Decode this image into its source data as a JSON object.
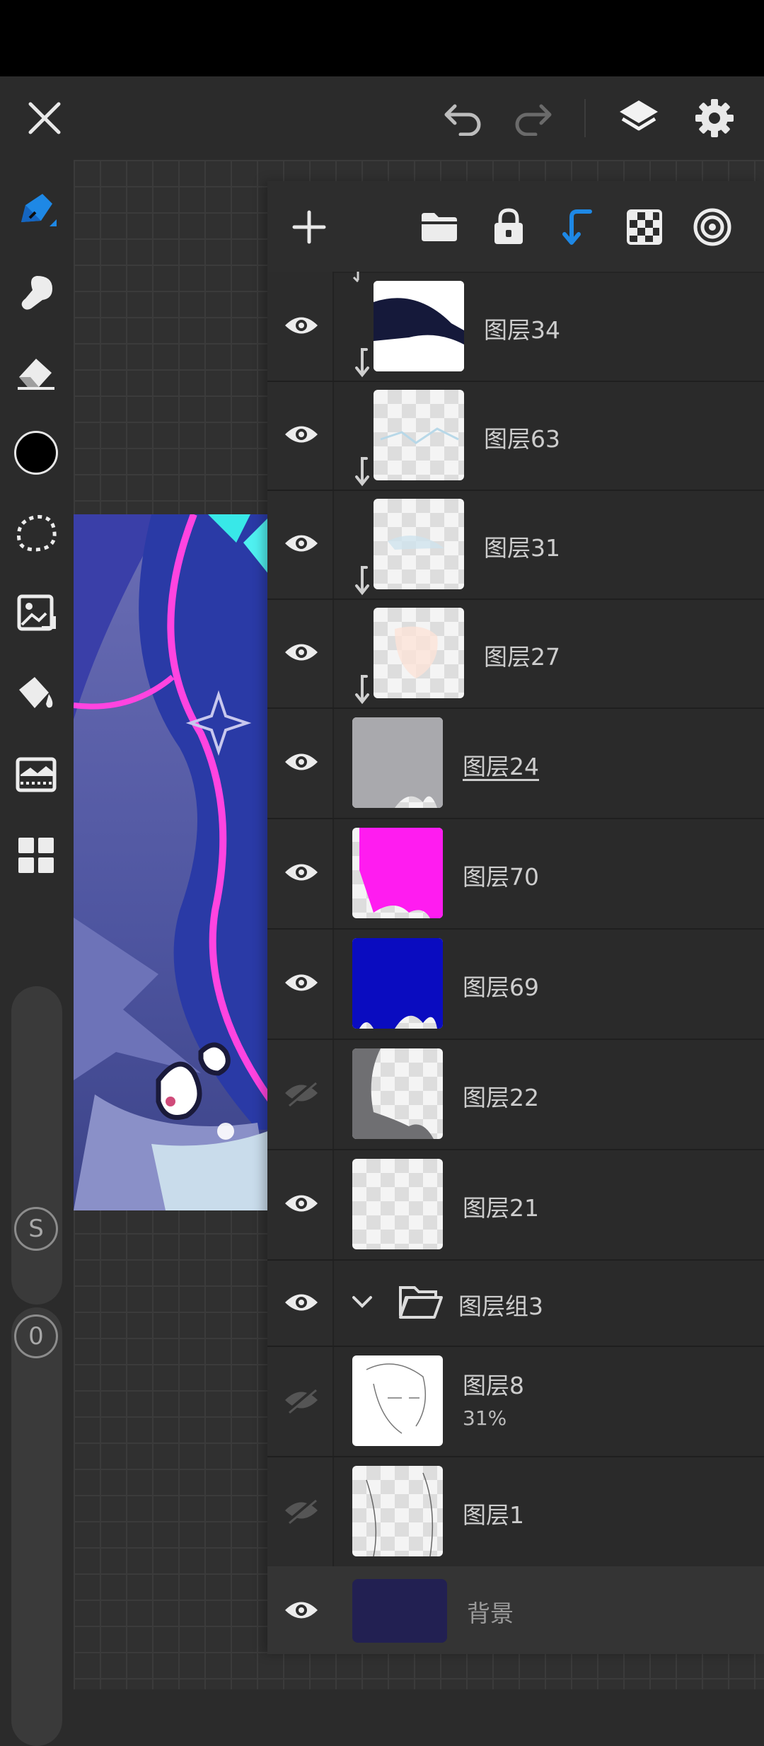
{
  "colors": {
    "accent": "#1e88e5",
    "panel_bg": "#2a2a2a",
    "current_color": "#000000",
    "background_swatch": "#222052"
  },
  "topbar": {
    "icons": [
      "close-icon",
      "undo-icon",
      "redo-icon",
      "layers-icon",
      "settings-icon"
    ]
  },
  "toolbar": {
    "tools": [
      "brush-icon",
      "smudge-icon",
      "eraser-icon",
      "color-swatch",
      "lasso-icon",
      "image-transform-icon",
      "fill-bucket-icon",
      "adjustment-icon",
      "grid-menu-icon"
    ],
    "badge_s": "S",
    "badge_0": "0"
  },
  "layers_panel": {
    "header_icons": [
      "add-icon",
      "folder-icon",
      "lock-icon",
      "clip-icon",
      "transparency-icon",
      "blend-icon"
    ],
    "layers": [
      {
        "name": "图层34",
        "visible": true,
        "clipped": true
      },
      {
        "name": "图层63",
        "visible": true,
        "clipped": true
      },
      {
        "name": "图层31",
        "visible": true,
        "clipped": true
      },
      {
        "name": "图层27",
        "visible": true,
        "clipped": true
      },
      {
        "name": "图层24",
        "visible": true,
        "selected": true
      },
      {
        "name": "图层70",
        "visible": true
      },
      {
        "name": "图层69",
        "visible": true
      },
      {
        "name": "图层22",
        "visible": false
      },
      {
        "name": "图层21",
        "visible": true
      }
    ],
    "group": {
      "name": "图层组3",
      "visible": true,
      "expanded": true
    },
    "group_layers": [
      {
        "name": "图层8",
        "opacity": "31%",
        "visible": false
      },
      {
        "name": "图层1",
        "visible": false
      }
    ],
    "background": {
      "name": "背景",
      "visible": true
    }
  }
}
